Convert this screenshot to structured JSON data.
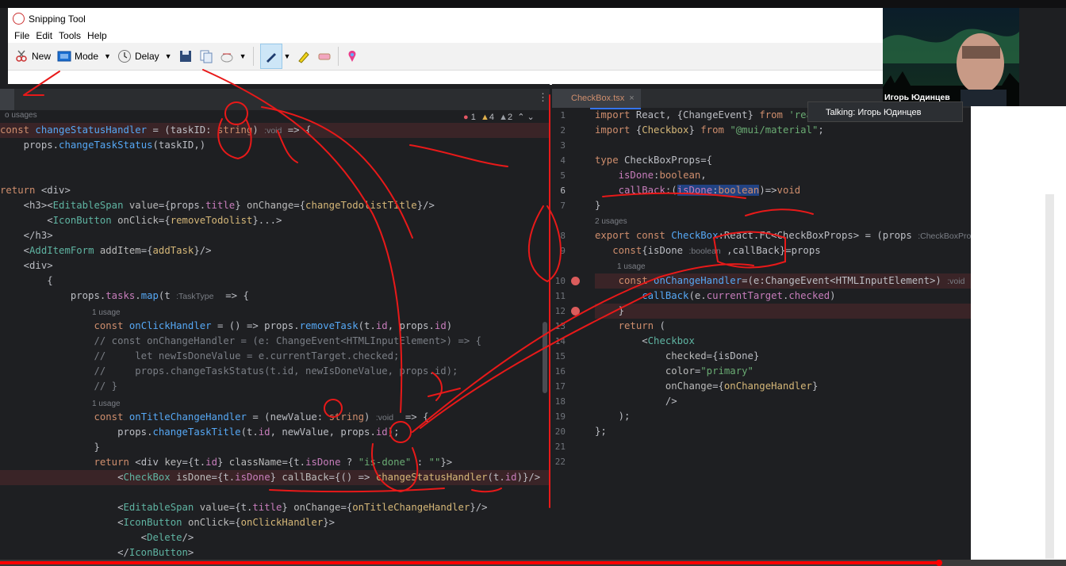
{
  "snipping_tool": {
    "title": "Snipping Tool",
    "menu": [
      "File",
      "Edit",
      "Tools",
      "Help"
    ],
    "new_label": "New",
    "mode_label": "Mode",
    "delay_label": "Delay"
  },
  "left_editor": {
    "inspections": {
      "errors": "1",
      "warnings": "4",
      "weak": "2"
    },
    "usage_top": "o usages",
    "usage_1": "1 usage",
    "usage_2": "1 usage",
    "lines": [
      {
        "text": "const changeStatusHandler = (taskID: string) :void => {"
      },
      {
        "text": "    props.changeTaskStatus(taskID,)"
      },
      {
        "text": ""
      },
      {
        "text": "return <div>"
      },
      {
        "text": "    <h3><EditableSpan value={props.title} onChange={changeTodolistTitle}/>"
      },
      {
        "text": "        <IconButton onClick={removeTodolist}...>"
      },
      {
        "text": "    </h3>"
      },
      {
        "text": "    <AddItemForm addItem={addTask}/>"
      },
      {
        "text": "    <div>"
      },
      {
        "text": "        {"
      },
      {
        "text": "            props.tasks.map(t :TaskType  => {"
      },
      {
        "text": "                const onClickHandler = () => props.removeTask(t.id, props.id)"
      },
      {
        "text": "                // const onChangeHandler = (e: ChangeEvent<HTMLInputElement>) => {"
      },
      {
        "text": "                //     let newIsDoneValue = e.currentTarget.checked;"
      },
      {
        "text": "                //     props.changeTaskStatus(t.id, newIsDoneValue, props.id);"
      },
      {
        "text": "                // }"
      },
      {
        "text": "                const onTitleChangeHandler = (newValue: string) :void  => {"
      },
      {
        "text": "                    props.changeTaskTitle(t.id, newValue, props.id);"
      },
      {
        "text": "                }"
      },
      {
        "text": "                return <div key={t.id} className={t.isDone ? \"is-done\" : \"\"}>"
      },
      {
        "text": "                    <CheckBox isDone={t.isDone} callBack={() => changeStatusHandler(t.id)}/>"
      },
      {
        "text": ""
      },
      {
        "text": "                    <EditableSpan value={t.title} onChange={onTitleChangeHandler}/>"
      },
      {
        "text": "                    <IconButton onClick={onClickHandler}>"
      },
      {
        "text": "                        <Delete/>"
      },
      {
        "text": "                    </IconButton>"
      }
    ]
  },
  "right_editor": {
    "tab_label": "CheckBox.tsx",
    "line_numbers": [
      "1",
      "2",
      "3",
      "4",
      "5",
      "6",
      "7",
      "8",
      "9",
      "10",
      "11",
      "12",
      "13",
      "14",
      "15",
      "16",
      "17",
      "18",
      "19",
      "20",
      "21",
      "22"
    ],
    "usage_a": "2 usages",
    "usage_b": "1 usage",
    "lines": [
      {
        "text": "import React, {ChangeEvent} from 'react"
      },
      {
        "text": "import {Checkbox} from \"@mui/material\";"
      },
      {
        "text": ""
      },
      {
        "text": "type CheckBoxProps={"
      },
      {
        "text": "    isDone:boolean,"
      },
      {
        "text": "    callBack:(isDone:boolean)=>void"
      },
      {
        "text": "}"
      },
      {
        "text": "export const CheckBox:React.FC<CheckBoxProps> = (props :CheckBoxProps"
      },
      {
        "text": "   const{isDone :boolean ,callBack}=props"
      },
      {
        "text": "    const onChangeHandler=(e:ChangeEvent<HTMLInputElement>) :void =>{"
      },
      {
        "text": "        callBack(e.currentTarget.checked)"
      },
      {
        "text": "    }"
      },
      {
        "text": "    return ("
      },
      {
        "text": "        <Checkbox"
      },
      {
        "text": "            checked={isDone}"
      },
      {
        "text": "            color=\"primary\""
      },
      {
        "text": "            onChange={onChangeHandler}"
      },
      {
        "text": "            />"
      },
      {
        "text": "    );"
      },
      {
        "text": "};"
      },
      {
        "text": ""
      },
      {
        "text": ""
      }
    ]
  },
  "meeting": {
    "speaker_name": "Игорь Юдинцев",
    "talking_label": "Talking: Игорь Юдинцев"
  },
  "colors": {
    "annotation_ink": "#e81919",
    "progress": "#ff0000"
  }
}
